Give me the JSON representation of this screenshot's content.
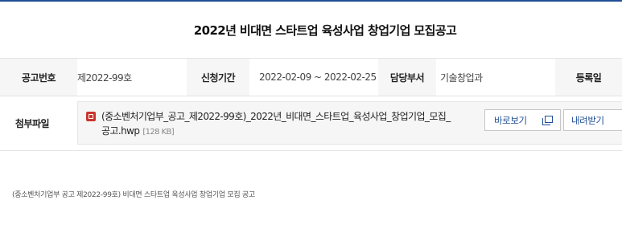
{
  "notice": {
    "title": "2022년 비대면 스타트업 육성사업 창업기업 모집공고"
  },
  "info": {
    "notice_no_label": "공고번호",
    "notice_no_value": "제2022-99호",
    "period_label": "신청기간",
    "period_value": "2022-02-09 ~ 2022-02-25",
    "dept_label": "담당부서",
    "dept_value": "기술창업과",
    "reg_label": "등록일"
  },
  "attachment": {
    "label": "첨부파일",
    "file_name_line1": "(중소벤처기업부_공고_제2022-99호)_2022년_비대면_스타트업_육성사업_창업기업_모집_",
    "file_name_line2": "공고.hwp",
    "file_size": "[128 KB]",
    "file_icon": "hwp-file-icon",
    "view_label": "바로보기",
    "download_label": "내려받기"
  },
  "content": {
    "body": "(중소벤처기업부 공고 제2022-99호) 비대면 스타트업 육성사업 창업기업 모집 공고"
  },
  "colors": {
    "accent": "#1f4e96",
    "file_icon": "#c8362e"
  }
}
